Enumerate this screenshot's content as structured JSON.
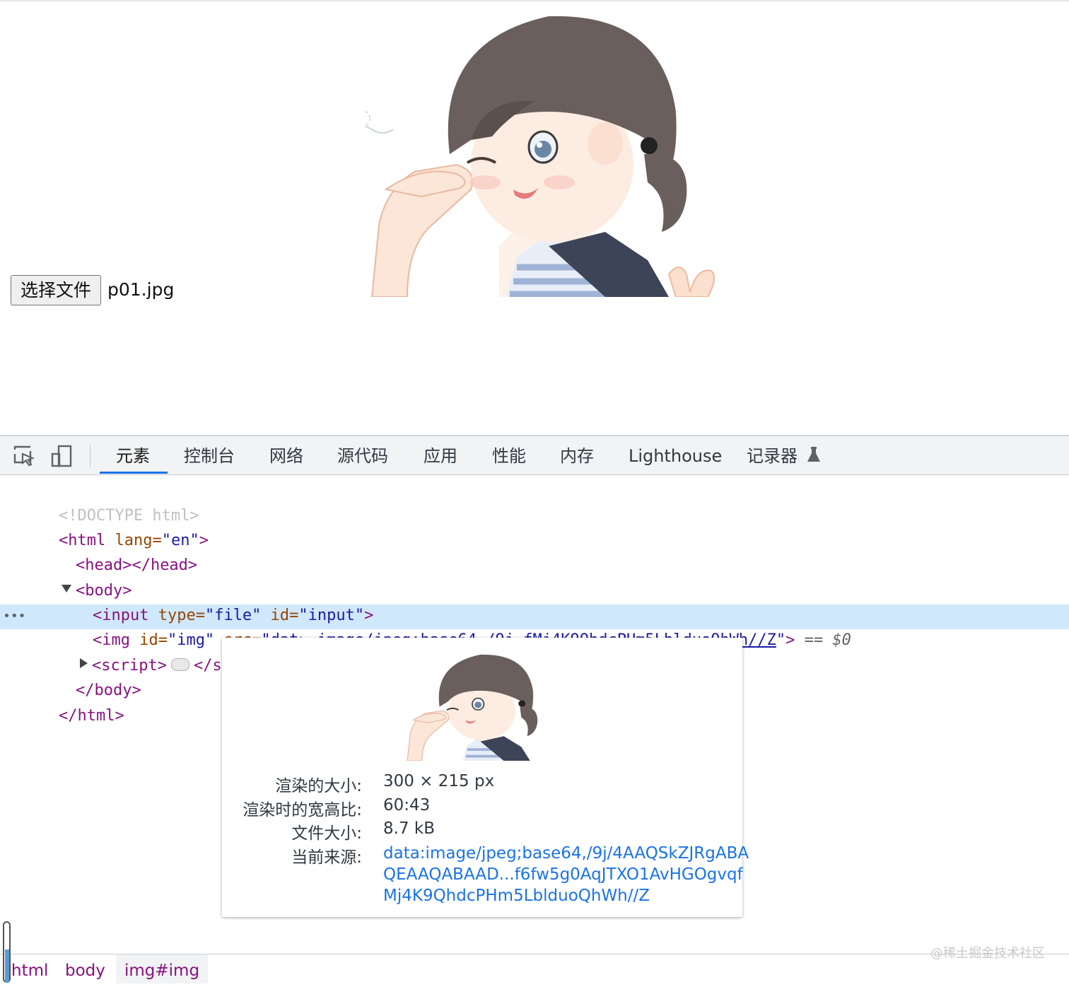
{
  "page": {
    "file_button_label": "选择文件",
    "file_name": "p01.jpg"
  },
  "devtools": {
    "tabs": [
      {
        "label": "元素",
        "active": true
      },
      {
        "label": "控制台"
      },
      {
        "label": "网络"
      },
      {
        "label": "源代码"
      },
      {
        "label": "应用"
      },
      {
        "label": "性能"
      },
      {
        "label": "内存"
      },
      {
        "label": "Lighthouse"
      },
      {
        "label": "记录器"
      }
    ],
    "dom": {
      "doctype": "<!DOCTYPE html>",
      "html_open_tag": "<html",
      "html_lang_attr": " lang=",
      "html_lang_val": "\"en\"",
      "close_bracket": ">",
      "head": "<head></head>",
      "body_open": "<body>",
      "input_open": "<input",
      "input_type_attr": " type=",
      "input_type_val": "\"file\"",
      "input_id_attr": " id=",
      "input_id_val": "\"input\"",
      "img_open": "<img",
      "img_id_attr": " id=",
      "img_id_val": "\"img\"",
      "img_src_attr": " src=",
      "quote": "\"",
      "img_src_link": "data:image/jpeg;base64,/9j…fMj4K9QhdcPHm5LblduoQhWh//Z",
      "img_eq": " == ",
      "img_dollar": "$0",
      "selected_ellipsis": "•••",
      "script_open": "<script>",
      "script_close": "</scrip",
      "body_close": "</body>",
      "html_close": "</html>"
    },
    "tooltip": {
      "rendered_size_label": "渲染的大小:",
      "rendered_size_value": "300 × 215 px",
      "aspect_label": "渲染时的宽高比:",
      "aspect_value": "60:43",
      "file_size_label": "文件大小:",
      "file_size_value": "8.7 kB",
      "source_label": "当前来源:",
      "source_value_1": "data:image/jpeg;base64,/9j/4AAQSkZJRgABA",
      "source_value_2": "QEAAQABAAD...f6fw5g0AqJTXO1AvHGOgvqf",
      "source_value_3": "Mj4K9QhdcPHm5LblduoQhWh//Z"
    },
    "breadcrumbs": [
      "html",
      "body",
      "img#img"
    ]
  },
  "watermark": "@稀土掘金技术社区",
  "colors": {
    "tag": "#881280",
    "attr": "#994500",
    "value": "#1a1aa6",
    "selected_row": "#cfe8fc",
    "accent": "#1a73e8"
  }
}
